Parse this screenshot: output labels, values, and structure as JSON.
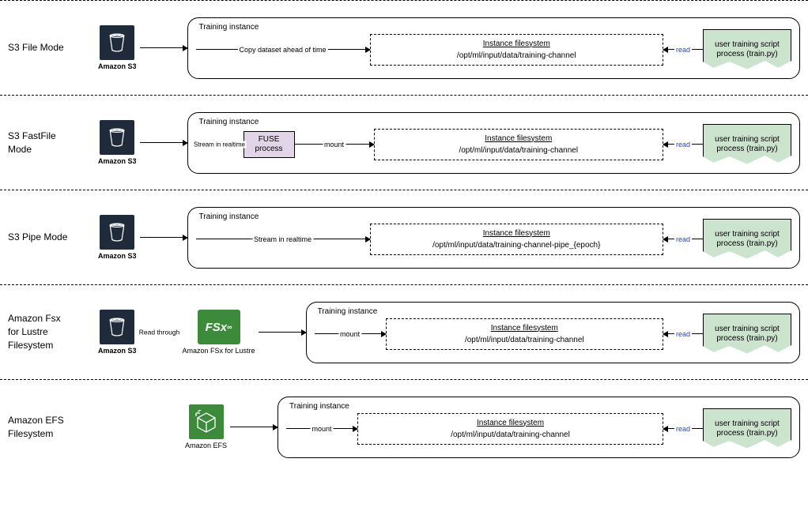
{
  "modes": {
    "file": {
      "label": "S3 File Mode",
      "service": "Amazon S3",
      "arrow1": "Copy dataset ahead of time",
      "instance_label": "Training instance",
      "fs_header": "Instance filesystem",
      "fs_path": "/opt/ml/input/data/training-channel",
      "read_label": "read",
      "script": "user training script process (train.py)"
    },
    "fastfile": {
      "label": "S3 FastFile Mode",
      "service": "Amazon S3",
      "arrow1": "Stream in realtime",
      "fuse": "FUSE\nprocess",
      "mount": "mount",
      "instance_label": "Training instance",
      "fs_header": "Instance filesystem",
      "fs_path": "/opt/ml/input/data/training-channel",
      "read_label": "read",
      "script": "user training script process (train.py)"
    },
    "pipe": {
      "label": "S3 Pipe Mode",
      "service": "Amazon S3",
      "arrow1": "Stream in realtime",
      "instance_label": "Training instance",
      "fs_header": "Instance filesystem",
      "fs_path": "/opt/ml/input/data/training-channel-pipe_{epoch}",
      "read_label": "read",
      "script": "user training script process (train.py)"
    },
    "fsx": {
      "label": "Amazon Fsx for Lustre Filesystem",
      "service_s3": "Amazon S3",
      "service_fsx": "Amazon FSx for Lustre",
      "read_through": "Read through",
      "mount": "mount",
      "instance_label": "Training instance",
      "fs_header": "Instance filesystem",
      "fs_path": "/opt/ml/input/data/training-channel",
      "read_label": "read",
      "script": "user training script process (train.py)"
    },
    "efs": {
      "label": "Amazon EFS Filesystem",
      "service_efs": "Amazon EFS",
      "mount": "mount",
      "instance_label": "Training instance",
      "fs_header": "Instance filesystem",
      "fs_path": "/opt/ml/input/data/training-channel",
      "read_label": "read",
      "script": "user training script process (train.py)"
    }
  }
}
